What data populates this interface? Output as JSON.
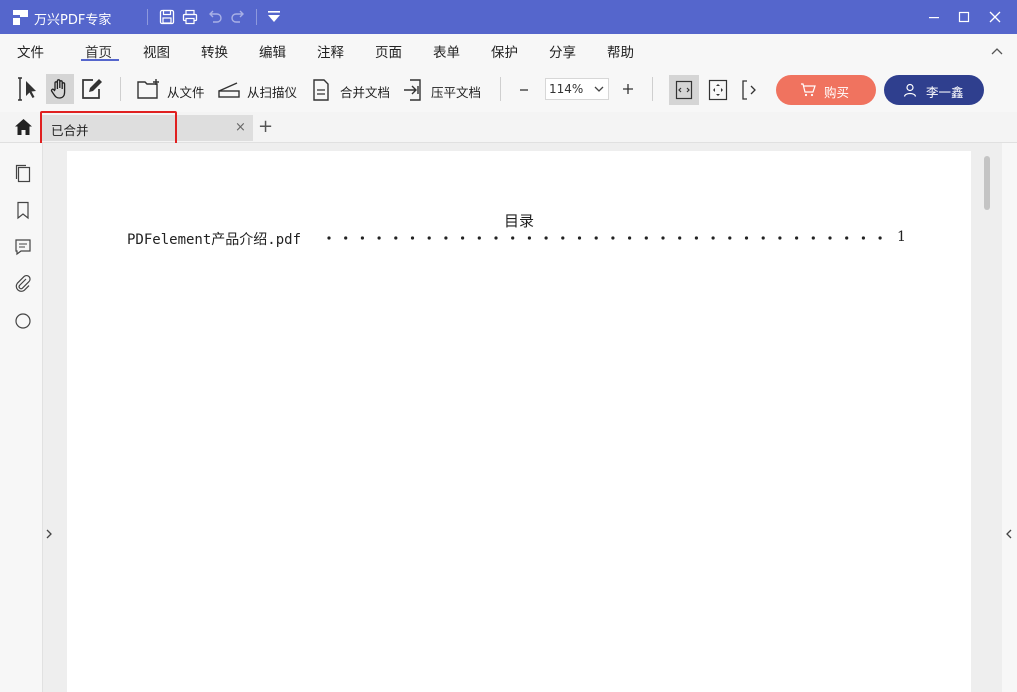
{
  "titlebar": {
    "app_title": "万兴PDF专家",
    "quick_icons": [
      "save-icon",
      "print-icon",
      "undo-icon",
      "redo-icon",
      "dropdown-icon"
    ],
    "window_controls": [
      "minimize-icon",
      "maximize-icon",
      "close-icon"
    ]
  },
  "menu": {
    "items": [
      "文件",
      "首页",
      "视图",
      "转换",
      "编辑",
      "注释",
      "页面",
      "表单",
      "保护",
      "分享",
      "帮助"
    ],
    "active_index": 1
  },
  "toolbar": {
    "from_file": "从文件",
    "from_scanner": "从扫描仪",
    "merge_docs": "合并文档",
    "flatten_doc": "压平文档",
    "zoom_value": "114%",
    "buy_label": "购买",
    "user_label": "李一鑫"
  },
  "tabs": {
    "doc_tab_label": "已合并",
    "close_glyph": "×",
    "add_glyph": "+"
  },
  "document": {
    "toc_title": "目录",
    "entries": [
      {
        "name": "PDFelement产品介绍.pdf",
        "page": "1"
      }
    ]
  },
  "colors": {
    "titlebar": "#5566cc",
    "buy_button": "#f0735f",
    "user_button": "#2f3f8e",
    "highlight": "#e02020"
  }
}
